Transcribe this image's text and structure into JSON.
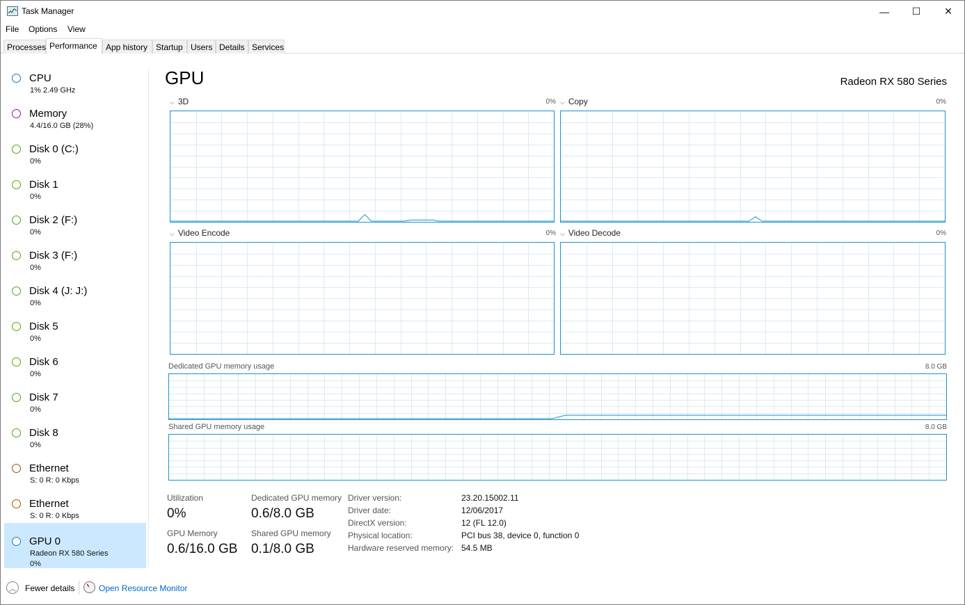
{
  "window": {
    "title": "Task Manager",
    "minimize_glyph": "—",
    "maximize_glyph": "☐",
    "close_glyph": "✕"
  },
  "menu": [
    {
      "label": "File"
    },
    {
      "label": "Options"
    },
    {
      "label": "View"
    }
  ],
  "tabs": [
    {
      "label": "Processes"
    },
    {
      "label": "Performance"
    },
    {
      "label": "App history"
    },
    {
      "label": "Startup"
    },
    {
      "label": "Users"
    },
    {
      "label": "Details"
    },
    {
      "label": "Services"
    }
  ],
  "active_tab": "Performance",
  "sidebar": {
    "items": [
      {
        "title": "CPU",
        "subtitle": "1%  2.49 GHz",
        "color": "#1779ba"
      },
      {
        "title": "Memory",
        "subtitle": "4.4/16.0 GB (28%)",
        "color": "#8b12ae"
      },
      {
        "title": "Disk 0 (C:)",
        "subtitle": "0%",
        "color": "#4da60c"
      },
      {
        "title": "Disk 1",
        "subtitle": "0%",
        "color": "#4da60c"
      },
      {
        "title": "Disk 2 (F:)",
        "subtitle": "0%",
        "color": "#4da60c"
      },
      {
        "title": "Disk 3 (F:)",
        "subtitle": "0%",
        "color": "#4da60c"
      },
      {
        "title": "Disk 4 (J: J:)",
        "subtitle": "0%",
        "color": "#4da60c"
      },
      {
        "title": "Disk 5",
        "subtitle": "0%",
        "color": "#4da60c"
      },
      {
        "title": "Disk 6",
        "subtitle": "0%",
        "color": "#4da60c"
      },
      {
        "title": "Disk 7",
        "subtitle": "0%",
        "color": "#4da60c"
      },
      {
        "title": "Disk 8",
        "subtitle": "0%",
        "color": "#4da60c"
      },
      {
        "title": "Ethernet",
        "subtitle": "S: 0  R: 0 Kbps",
        "color": "#a74f01"
      },
      {
        "title": "Ethernet",
        "subtitle": "S: 0  R: 0 Kbps",
        "color": "#a74f01"
      },
      {
        "title": "GPU 0",
        "subtitle": "Radeon RX 580 Series",
        "subtitle2": "0%",
        "color": "#1779ba"
      }
    ],
    "selected": "GPU 0"
  },
  "main": {
    "title": "GPU",
    "model": "Radeon RX 580 Series",
    "engines": [
      {
        "label": "3D",
        "max": "0%",
        "peaks": [
          0.06,
          0.01
        ]
      },
      {
        "label": "Copy",
        "max": "0%",
        "peaks": [
          0.04
        ]
      },
      {
        "label": "Video Encode",
        "max": "0%",
        "peaks": []
      },
      {
        "label": "Video Decode",
        "max": "0%",
        "peaks": []
      }
    ],
    "dedicated_memory": {
      "label": "Dedicated GPU memory usage",
      "max": "8.0 GB",
      "fraction": 0.075
    },
    "shared_memory": {
      "label": "Shared GPU memory usage",
      "max": "8.0 GB",
      "fraction": 0.0
    }
  },
  "stats": {
    "utilization": {
      "label": "Utilization",
      "value": "0%"
    },
    "dedicated": {
      "label": "Dedicated GPU memory",
      "value": "0.6/8.0 GB"
    },
    "gpu_memory": {
      "label": "GPU Memory",
      "value": "0.6/16.0 GB"
    },
    "shared": {
      "label": "Shared GPU memory",
      "value": "0.1/8.0 GB"
    }
  },
  "info": [
    {
      "key": "Driver version:",
      "value": "23.20.15002.11"
    },
    {
      "key": "Driver date:",
      "value": "12/06/2017"
    },
    {
      "key": "DirectX version:",
      "value": "12 (FL 12.0)"
    },
    {
      "key": "Physical location:",
      "value": "PCI bus 38, device 0, function 0"
    },
    {
      "key": "Hardware reserved memory:",
      "value": "54.5 MB"
    }
  ],
  "footer": {
    "fewer_details": "Fewer details",
    "open_resource_monitor": "Open Resource Monitor"
  },
  "colors": {
    "chart_line": "#1a91c9",
    "grid": "#d9eaf5",
    "selected_bg": "#cce8ff",
    "link": "#0066cc"
  }
}
